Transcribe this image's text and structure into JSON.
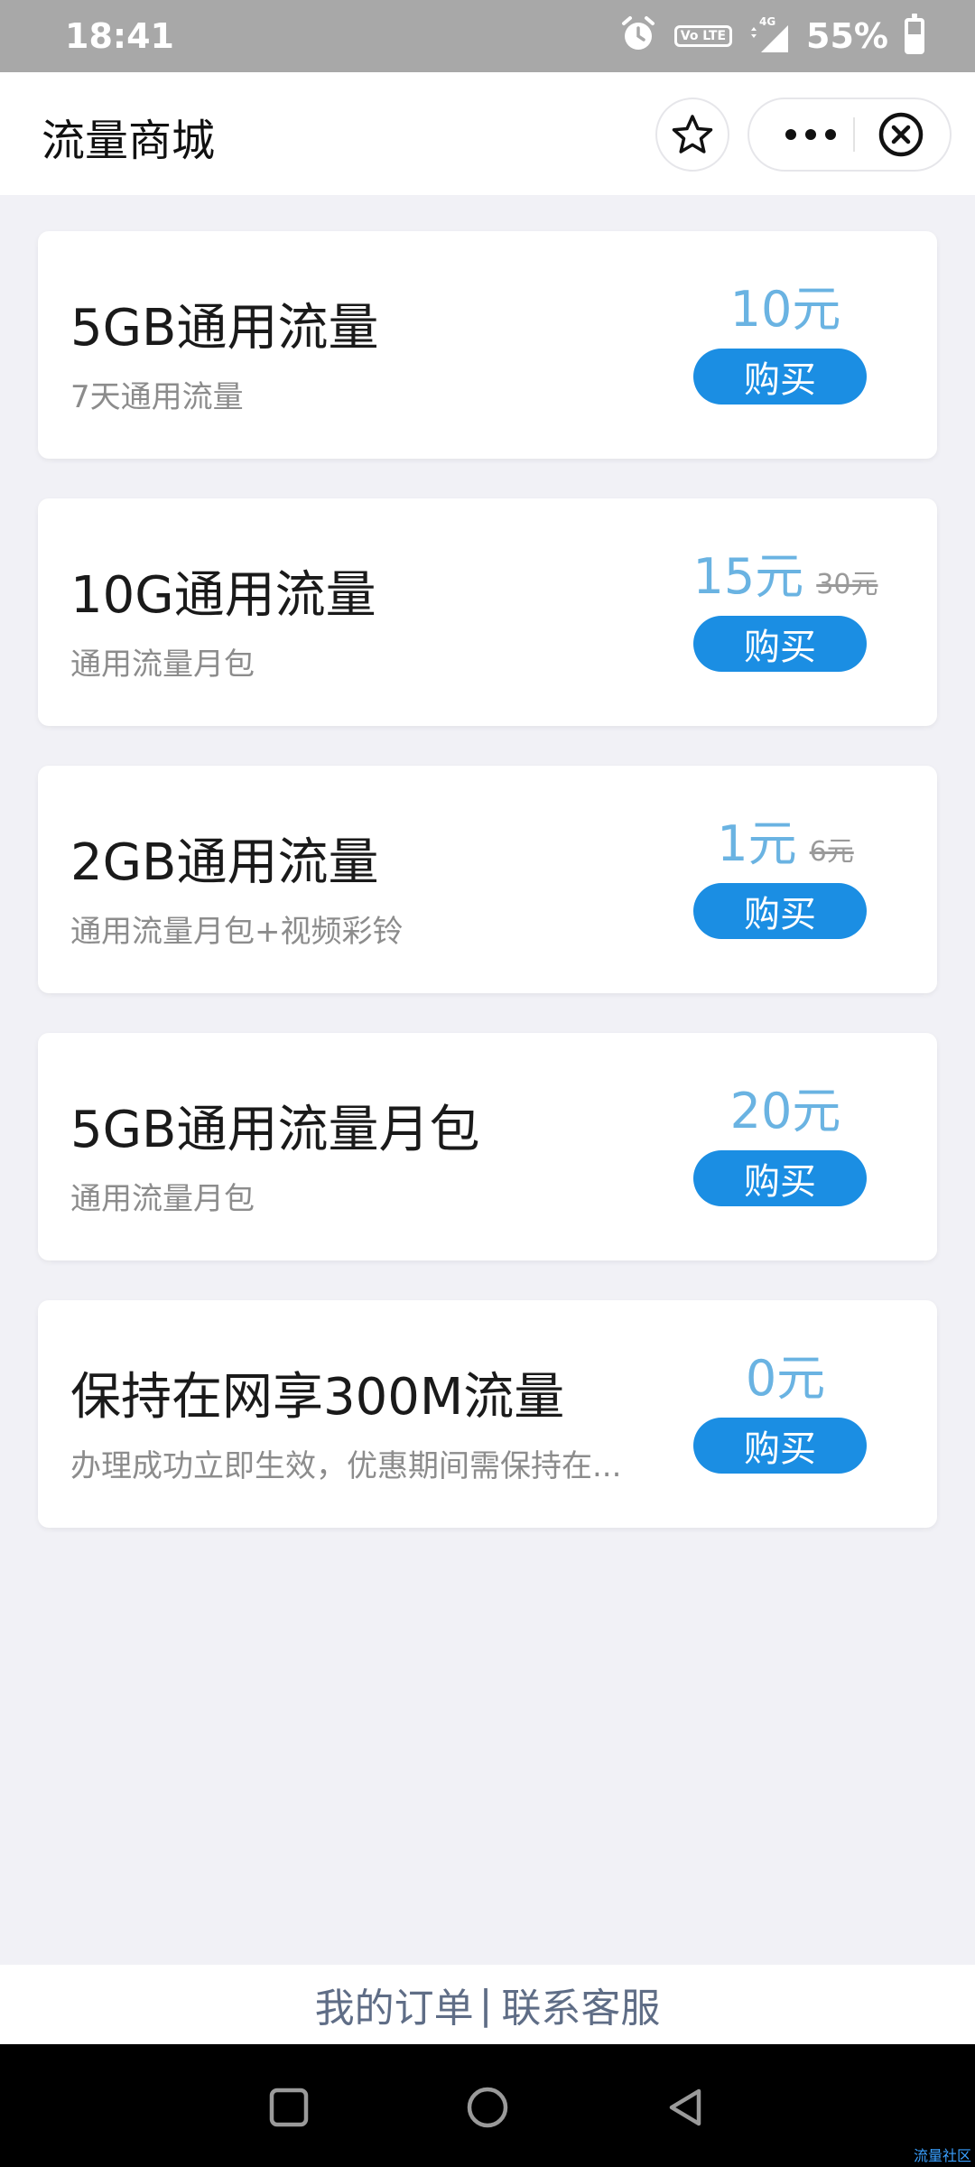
{
  "status_bar": {
    "time": "18:41",
    "volte": "Vo LTE",
    "network": "4G",
    "battery": "55%",
    "battery_level": 0.55,
    "icons": [
      "alarm-icon",
      "volte-icon",
      "signal-icon",
      "battery-icon"
    ]
  },
  "nav": {
    "title": "流量商城",
    "icons": [
      "star-icon",
      "more-icon",
      "close-circle-icon"
    ]
  },
  "products": [
    {
      "name": "5GB通用流量",
      "desc": "7天通用流量",
      "price": "10元",
      "old_price": "",
      "buy": "购买"
    },
    {
      "name": "10G通用流量",
      "desc": "通用流量月包",
      "price": "15元",
      "old_price": "30元",
      "buy": "购买"
    },
    {
      "name": "2GB通用流量",
      "desc": "通用流量月包+视频彩铃",
      "price": "1元",
      "old_price": "6元",
      "buy": "购买"
    },
    {
      "name": "5GB通用流量月包",
      "desc": "通用流量月包",
      "price": "20元",
      "old_price": "",
      "buy": "购买"
    },
    {
      "name": "保持在网享300M流量",
      "desc": "办理成功立即生效，优惠期间需保持在...",
      "price": "0元",
      "old_price": "",
      "buy": "购买"
    }
  ],
  "footer": {
    "orders": "我的订单",
    "separator": "|",
    "service": "联系客服"
  },
  "system_nav": {
    "icons": [
      "recent-apps-icon",
      "home-icon",
      "back-icon"
    ]
  },
  "watermark": "流量社区",
  "colors": {
    "accent": "#1b8ee3",
    "price": "#6ab3e2",
    "background": "#f1f1f6",
    "status_bar": "#a8a8a8"
  }
}
